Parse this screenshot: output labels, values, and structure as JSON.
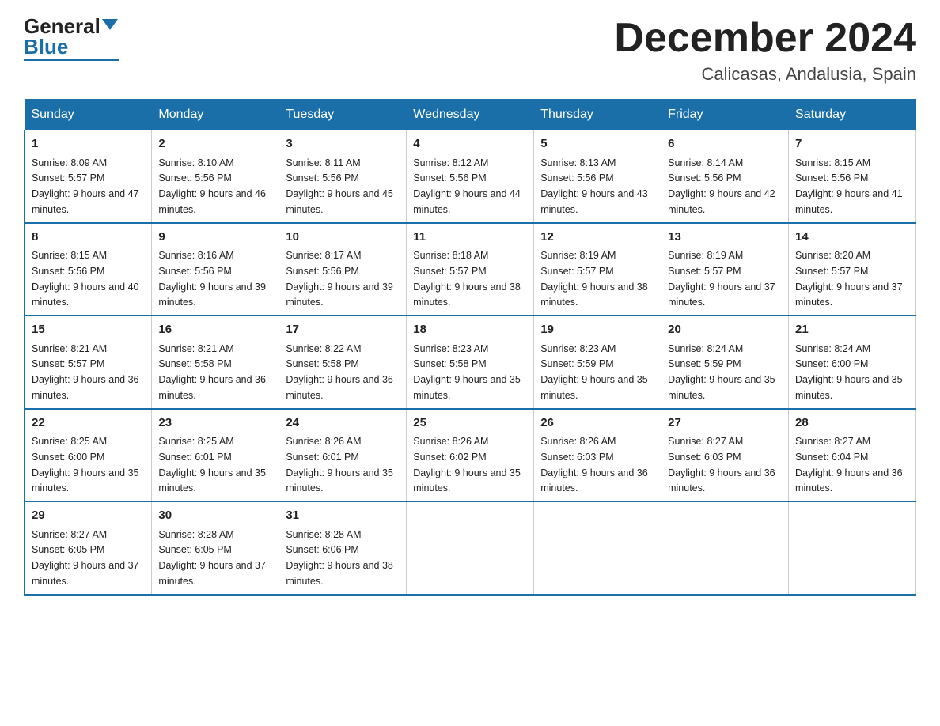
{
  "logo": {
    "general": "General",
    "blue": "Blue"
  },
  "title": "December 2024",
  "location": "Calicasas, Andalusia, Spain",
  "weekdays": [
    "Sunday",
    "Monday",
    "Tuesday",
    "Wednesday",
    "Thursday",
    "Friday",
    "Saturday"
  ],
  "weeks": [
    [
      {
        "day": "1",
        "sunrise": "8:09 AM",
        "sunset": "5:57 PM",
        "daylight": "9 hours and 47 minutes."
      },
      {
        "day": "2",
        "sunrise": "8:10 AM",
        "sunset": "5:56 PM",
        "daylight": "9 hours and 46 minutes."
      },
      {
        "day": "3",
        "sunrise": "8:11 AM",
        "sunset": "5:56 PM",
        "daylight": "9 hours and 45 minutes."
      },
      {
        "day": "4",
        "sunrise": "8:12 AM",
        "sunset": "5:56 PM",
        "daylight": "9 hours and 44 minutes."
      },
      {
        "day": "5",
        "sunrise": "8:13 AM",
        "sunset": "5:56 PM",
        "daylight": "9 hours and 43 minutes."
      },
      {
        "day": "6",
        "sunrise": "8:14 AM",
        "sunset": "5:56 PM",
        "daylight": "9 hours and 42 minutes."
      },
      {
        "day": "7",
        "sunrise": "8:15 AM",
        "sunset": "5:56 PM",
        "daylight": "9 hours and 41 minutes."
      }
    ],
    [
      {
        "day": "8",
        "sunrise": "8:15 AM",
        "sunset": "5:56 PM",
        "daylight": "9 hours and 40 minutes."
      },
      {
        "day": "9",
        "sunrise": "8:16 AM",
        "sunset": "5:56 PM",
        "daylight": "9 hours and 39 minutes."
      },
      {
        "day": "10",
        "sunrise": "8:17 AM",
        "sunset": "5:56 PM",
        "daylight": "9 hours and 39 minutes."
      },
      {
        "day": "11",
        "sunrise": "8:18 AM",
        "sunset": "5:57 PM",
        "daylight": "9 hours and 38 minutes."
      },
      {
        "day": "12",
        "sunrise": "8:19 AM",
        "sunset": "5:57 PM",
        "daylight": "9 hours and 38 minutes."
      },
      {
        "day": "13",
        "sunrise": "8:19 AM",
        "sunset": "5:57 PM",
        "daylight": "9 hours and 37 minutes."
      },
      {
        "day": "14",
        "sunrise": "8:20 AM",
        "sunset": "5:57 PM",
        "daylight": "9 hours and 37 minutes."
      }
    ],
    [
      {
        "day": "15",
        "sunrise": "8:21 AM",
        "sunset": "5:57 PM",
        "daylight": "9 hours and 36 minutes."
      },
      {
        "day": "16",
        "sunrise": "8:21 AM",
        "sunset": "5:58 PM",
        "daylight": "9 hours and 36 minutes."
      },
      {
        "day": "17",
        "sunrise": "8:22 AM",
        "sunset": "5:58 PM",
        "daylight": "9 hours and 36 minutes."
      },
      {
        "day": "18",
        "sunrise": "8:23 AM",
        "sunset": "5:58 PM",
        "daylight": "9 hours and 35 minutes."
      },
      {
        "day": "19",
        "sunrise": "8:23 AM",
        "sunset": "5:59 PM",
        "daylight": "9 hours and 35 minutes."
      },
      {
        "day": "20",
        "sunrise": "8:24 AM",
        "sunset": "5:59 PM",
        "daylight": "9 hours and 35 minutes."
      },
      {
        "day": "21",
        "sunrise": "8:24 AM",
        "sunset": "6:00 PM",
        "daylight": "9 hours and 35 minutes."
      }
    ],
    [
      {
        "day": "22",
        "sunrise": "8:25 AM",
        "sunset": "6:00 PM",
        "daylight": "9 hours and 35 minutes."
      },
      {
        "day": "23",
        "sunrise": "8:25 AM",
        "sunset": "6:01 PM",
        "daylight": "9 hours and 35 minutes."
      },
      {
        "day": "24",
        "sunrise": "8:26 AM",
        "sunset": "6:01 PM",
        "daylight": "9 hours and 35 minutes."
      },
      {
        "day": "25",
        "sunrise": "8:26 AM",
        "sunset": "6:02 PM",
        "daylight": "9 hours and 35 minutes."
      },
      {
        "day": "26",
        "sunrise": "8:26 AM",
        "sunset": "6:03 PM",
        "daylight": "9 hours and 36 minutes."
      },
      {
        "day": "27",
        "sunrise": "8:27 AM",
        "sunset": "6:03 PM",
        "daylight": "9 hours and 36 minutes."
      },
      {
        "day": "28",
        "sunrise": "8:27 AM",
        "sunset": "6:04 PM",
        "daylight": "9 hours and 36 minutes."
      }
    ],
    [
      {
        "day": "29",
        "sunrise": "8:27 AM",
        "sunset": "6:05 PM",
        "daylight": "9 hours and 37 minutes."
      },
      {
        "day": "30",
        "sunrise": "8:28 AM",
        "sunset": "6:05 PM",
        "daylight": "9 hours and 37 minutes."
      },
      {
        "day": "31",
        "sunrise": "8:28 AM",
        "sunset": "6:06 PM",
        "daylight": "9 hours and 38 minutes."
      },
      null,
      null,
      null,
      null
    ]
  ],
  "sunrise_label": "Sunrise:",
  "sunset_label": "Sunset:",
  "daylight_label": "Daylight:"
}
